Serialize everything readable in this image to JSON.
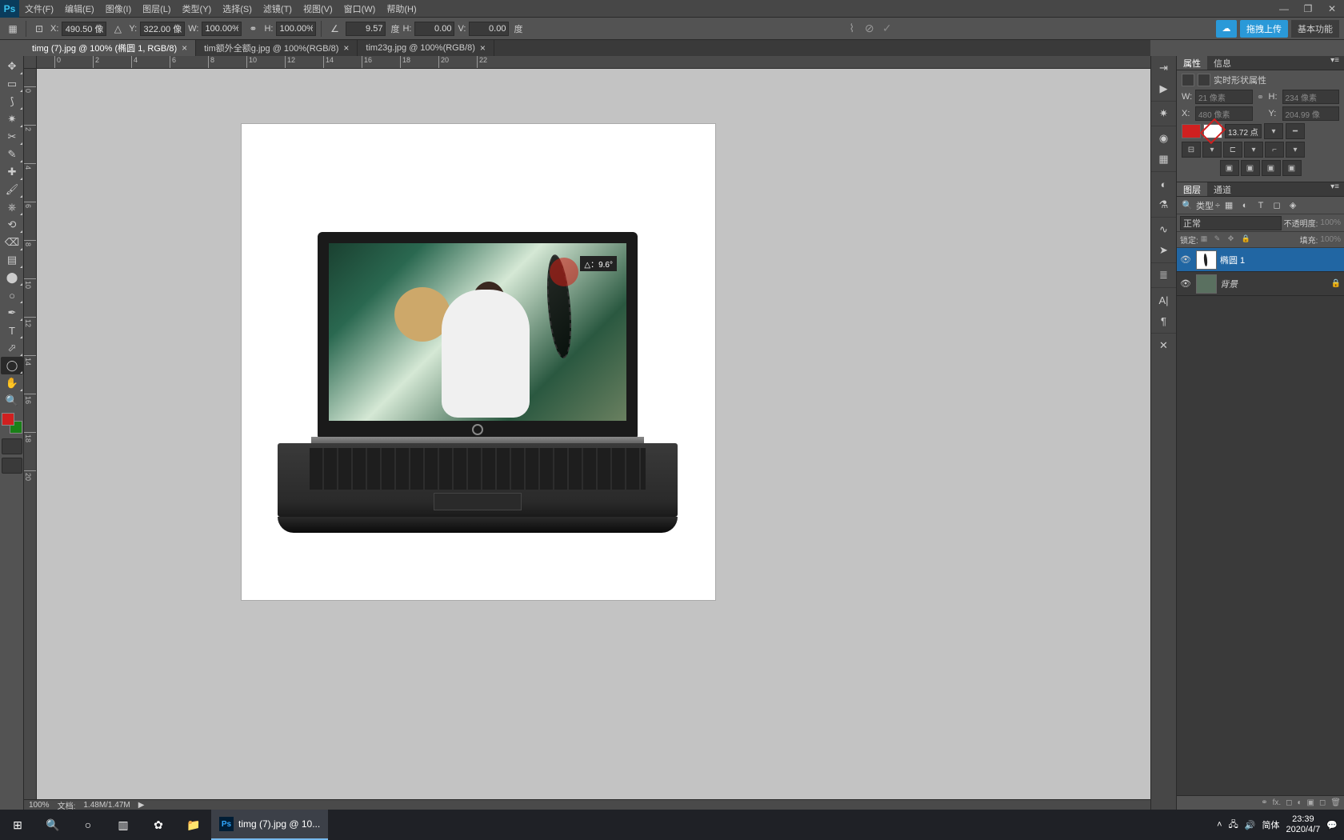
{
  "menu": [
    "文件(F)",
    "编辑(E)",
    "图像(I)",
    "图层(L)",
    "类型(Y)",
    "选择(S)",
    "滤镜(T)",
    "视图(V)",
    "窗口(W)",
    "帮助(H)"
  ],
  "optionbar": {
    "x_val": "490.50 像",
    "y_val": "322.00 像",
    "w_pct": "100.00%",
    "h_pct": "100.00%",
    "angle": "9.57",
    "angle_unit": "度",
    "h_skew": "0.00",
    "v_skew": "0.00",
    "v_unit": "度",
    "x_lbl": "X:",
    "y_lbl": "Y:",
    "w_lbl": "W:",
    "h_lbl": "H:",
    "hs_lbl": "H:",
    "vs_lbl": "V:"
  },
  "top_right": {
    "upload": "拖拽上传",
    "workspace": "基本功能"
  },
  "tabs": [
    {
      "title": "timg (7).jpg @ 100% (椭圆 1, RGB/8)",
      "active": true
    },
    {
      "title": "tim额外全额g.jpg @ 100%(RGB/8)",
      "active": false
    },
    {
      "title": "tim23g.jpg @ 100%(RGB/8)",
      "active": false
    }
  ],
  "rulers_h": [
    "0",
    "2",
    "4",
    "6",
    "8",
    "10",
    "12",
    "14",
    "16",
    "18",
    "20",
    "22"
  ],
  "rulers_v": [
    "0",
    "2",
    "4",
    "6",
    "8",
    "10",
    "12",
    "14",
    "16",
    "18",
    "20"
  ],
  "canvas": {
    "rotate_tag": "△：9.6°"
  },
  "status": {
    "zoom": "100%",
    "doc_label": "文档:",
    "doc": "1.48M/1.47M"
  },
  "panels": {
    "props_tab": "属性",
    "info_tab": "信息",
    "props_title": "实时形状属性",
    "w_lbl": "W:",
    "w_val": "21 像素",
    "h_lbl": "H:",
    "h_val": "234 像素",
    "x_lbl": "X:",
    "x_val": "480 像素",
    "y_lbl": "Y:",
    "y_val": "204.99 像",
    "stroke_w": "13.72 点",
    "layers_tab": "图层",
    "channels_tab": "通道",
    "filter_label": "类型",
    "blend": "正常",
    "opacity_lbl": "不透明度:",
    "opacity": "100%",
    "lock_lbl": "锁定:",
    "fill_lbl": "填充:",
    "fill": "100%",
    "layer1": "椭圆 1",
    "layer_bg": "背景"
  },
  "taskbar": {
    "task_title": "timg (7).jpg @ 10...",
    "ime": "简体",
    "time": "23:39",
    "date": "2020/4/7"
  }
}
